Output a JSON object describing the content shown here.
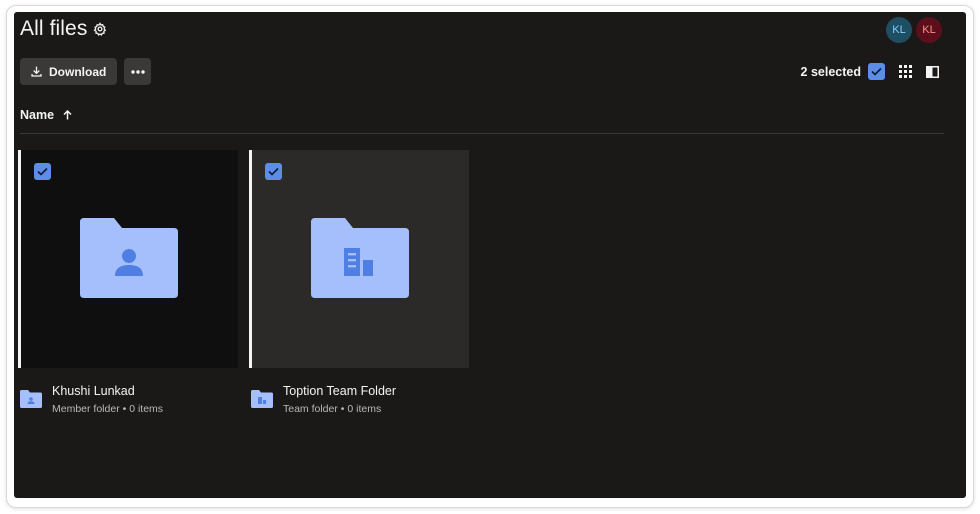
{
  "header": {
    "title": "All files",
    "avatars": [
      {
        "initials": "KL",
        "color": "#1f4e63"
      },
      {
        "initials": "KL",
        "color": "#5c0f1a"
      }
    ]
  },
  "toolbar": {
    "download_label": "Download",
    "selected_count": "2 selected"
  },
  "list_header": {
    "name_column": "Name",
    "sort": "ascending"
  },
  "files": [
    {
      "name": "Khushi Lunkad",
      "subtitle": "Member folder • 0 items",
      "icon": "member-folder-icon",
      "selected": true
    },
    {
      "name": "Toption Team Folder",
      "subtitle": "Team folder • 0 items",
      "icon": "team-folder-icon",
      "selected": true
    }
  ],
  "colors": {
    "background": "#1a1918",
    "accent": "#5c8ee8",
    "folder": "#a4bffb",
    "folder_glyph": "#4f7fe3"
  }
}
